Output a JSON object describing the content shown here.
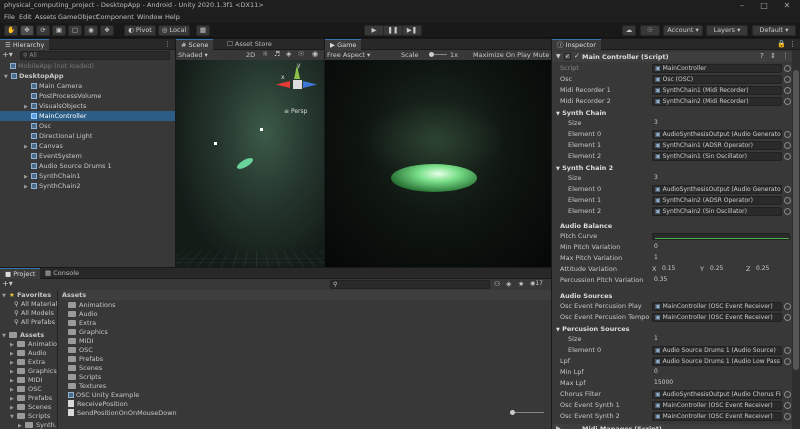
{
  "window": {
    "title": "physical_computing_project - DesktopApp - Android - Unity 2020.1.3f1 <DX11>"
  },
  "menu": [
    "File",
    "Edit",
    "Assets",
    "GameObject",
    "Component",
    "Window",
    "Help"
  ],
  "toolbar": {
    "pivot": "Pivot",
    "local": "Local",
    "account": "Account",
    "layers": "Layers",
    "layout": "Default"
  },
  "hierarchy": {
    "tab": "Hierarchy",
    "search": "All",
    "items": [
      "MobileApp (not loaded)",
      "DesktopApp",
      "Main Camera",
      "PostProcessVolume",
      "VisualsObjects",
      "MainController",
      "Osc",
      "Directional Light",
      "Canvas",
      "EventSystem",
      "Audio Source Drums 1",
      "SynthChain1",
      "SynthChain2"
    ]
  },
  "scene": {
    "tab": "Scene",
    "shading": "Shaded",
    "mode": "2D",
    "persp": "Persp",
    "axis_x": "x",
    "axis_y": "y"
  },
  "assetstore": {
    "tab": "Asset Store"
  },
  "game": {
    "tab": "Game",
    "aspect": "Free Aspect",
    "scale": "Scale",
    "scale_val": "1x",
    "maximize": "Maximize On Play",
    "mute": "Mute"
  },
  "project": {
    "tab": "Project",
    "console": "Console",
    "badge": "17",
    "favorites": "Favorites",
    "fav_items": [
      "All Materials",
      "All Models",
      "All Prefabs"
    ],
    "assets_root": "Assets",
    "tree": [
      "Animations",
      "Audio",
      "Extra",
      "Graphics",
      "MIDI",
      "OSC",
      "Prefabs",
      "Scenes",
      "Scripts",
      "Synth..."
    ],
    "breadcrumb": "Assets",
    "files": [
      "Animations",
      "Audio",
      "Extra",
      "Graphics",
      "MIDI",
      "OSC",
      "Prefabs",
      "Scenes",
      "Scripts",
      "Textures",
      "OSC Unity Example",
      "ReceivePosition",
      "SendPositionOnOnMouseDown"
    ]
  },
  "inspector": {
    "tab": "Inspector",
    "component": "Main Controller (Script)",
    "rows": [
      {
        "label": "Script",
        "value": "MainController"
      },
      {
        "label": "Osc",
        "value": "Osc (OSC)"
      },
      {
        "label": "Midi Recorder 1",
        "value": "SynthChain1 (Midi Recorder)"
      },
      {
        "label": "Midi Recorder 2",
        "value": "SynthChain2 (Midi Recorder)"
      }
    ],
    "synth1": {
      "title": "Synth Chain",
      "size_label": "Size",
      "size": "3",
      "elements": [
        {
          "label": "Element 0",
          "value": "AudioSynthesisOutput (Audio Generator)"
        },
        {
          "label": "Element 1",
          "value": "SynthChain1 (ADSR Operator)"
        },
        {
          "label": "Element 2",
          "value": "SynthChain1 (Sin Oscillator)"
        }
      ]
    },
    "synth2": {
      "title": "Synth Chain 2",
      "size_label": "Size",
      "size": "3",
      "elements": [
        {
          "label": "Element 0",
          "value": "AudioSynthesisOutput (Audio Generator)"
        },
        {
          "label": "Element 1",
          "value": "SynthChain2 (ADSR Operator)"
        },
        {
          "label": "Element 2",
          "value": "SynthChain2 (Sin Oscillator)"
        }
      ]
    },
    "balance": {
      "title": "Audio Balance",
      "pitch_curve": "Pitch Curve",
      "min_pitch": "Min Pitch Variation",
      "min_pitch_val": "0",
      "max_pitch": "Max Pitch Variation",
      "max_pitch_val": "1",
      "attr": "Attitude Variation",
      "x": "X",
      "xv": "0.15",
      "y": "Y",
      "yv": "0.25",
      "z": "Z",
      "zv": "0.25",
      "perc": "Percussion Pitch Variation",
      "perc_val": "0.35"
    },
    "sources": {
      "title": "Audio Sources",
      "play": "Osc Event Percusion Play",
      "play_val": "MainController (OSC Event Receiver)",
      "tempo": "Osc Event Percusion Tempo",
      "tempo_val": "MainController (OSC Event Receiver)",
      "perc_src": "Percusion Sources",
      "size_label": "Size",
      "size": "1",
      "el0": "Element 0",
      "el0_val": "Audio Source Drums 1 (Audio Source)",
      "lpf": "Lpf",
      "lpf_val": "Audio Source Drums 1 (Audio Low Pass",
      "min_lpf": "Min Lpf",
      "min_lpf_val": "0",
      "max_lpf": "Max Lpf",
      "max_lpf_val": "15000",
      "chorus": "Chorus Filter",
      "chorus_val": "AudioSynthesisOutput (Audio Chorus Fil",
      "synth1": "Osc Event Synth 1",
      "synth1_val": "MainController (OSC Event Receiver)",
      "synth2": "Osc Event Synth 2",
      "synth2_val": "MainController (OSC Event Receiver)"
    },
    "midi": "Midi Manager (Script)"
  },
  "colors": {
    "accent": "#2c5d87",
    "tab_underline": "#3a72b0",
    "bg": "#383838"
  }
}
